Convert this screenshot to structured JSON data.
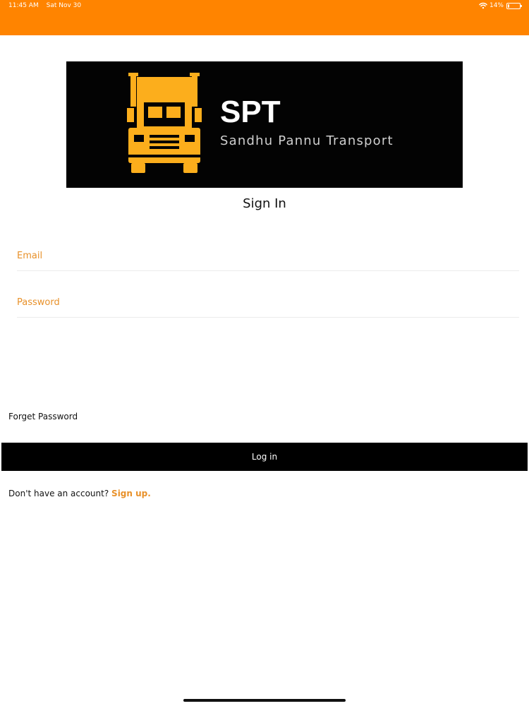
{
  "status_bar": {
    "time": "11:45 AM",
    "date": "Sat Nov 30",
    "battery": "14%",
    "battery_level": 0.14,
    "wifi_icon": "wifi-icon",
    "battery_icon": "battery-icon"
  },
  "logo": {
    "brand": "SPT",
    "tagline": "Sandhu Pannu Transport",
    "truck_icon": "truck-icon",
    "background": "#030303",
    "truck_color": "#fcae1c"
  },
  "form": {
    "title": "Sign In",
    "email_placeholder": "Email",
    "email_value": "",
    "password_placeholder": "Password",
    "password_value": "",
    "forget_password": "Forget Password",
    "login_label": "Log in",
    "signup_prompt": "Don't have an account?",
    "signup_link": "Sign up."
  },
  "colors": {
    "status_bar": "#ff8400",
    "accent": "#e8912a",
    "button": "#000000"
  }
}
